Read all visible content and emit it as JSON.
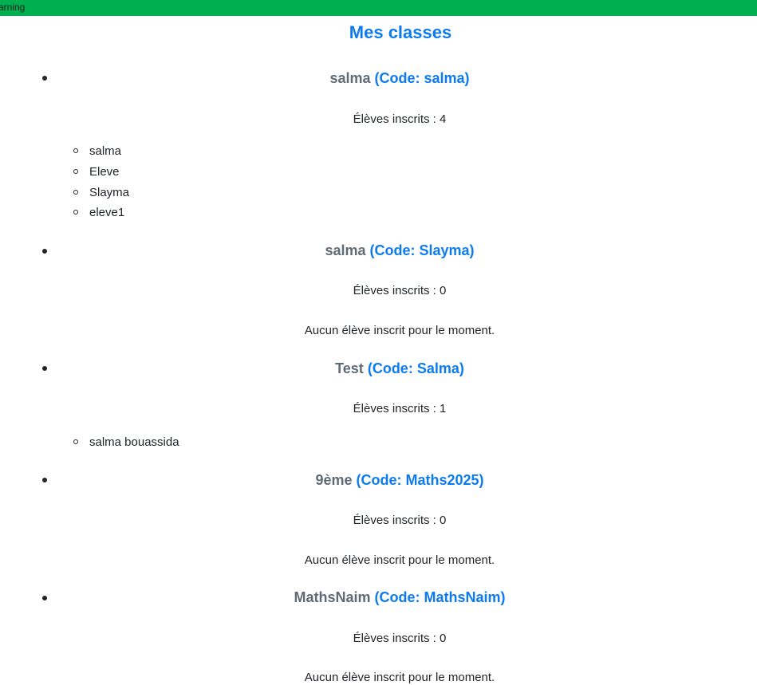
{
  "topbar": {
    "text": "arning",
    "color": "#00b050"
  },
  "page": {
    "title": "Mes classes"
  },
  "classes": [
    {
      "name": "salma",
      "code": "(Code: salma)",
      "count": "Élèves inscrits : 4",
      "students": [
        "salma",
        "Eleve",
        "Slayma",
        "eleve1"
      ],
      "empty": ""
    },
    {
      "name": "salma",
      "code": "(Code: Slayma)",
      "count": "Élèves inscrits : 0",
      "students": [],
      "empty": "Aucun élève inscrit pour le moment."
    },
    {
      "name": "Test",
      "code": "(Code: Salma)",
      "count": "Élèves inscrits : 1",
      "students": [
        "salma bouassida"
      ],
      "empty": ""
    },
    {
      "name": "9ème",
      "code": "(Code: Maths2025)",
      "count": "Élèves inscrits : 0",
      "students": [],
      "empty": "Aucun élève inscrit pour le moment."
    },
    {
      "name": "MathsNaim",
      "code": "(Code: MathsNaim)",
      "count": "Élèves inscrits : 0",
      "students": [],
      "empty": "Aucun élève inscrit pour le moment."
    }
  ]
}
